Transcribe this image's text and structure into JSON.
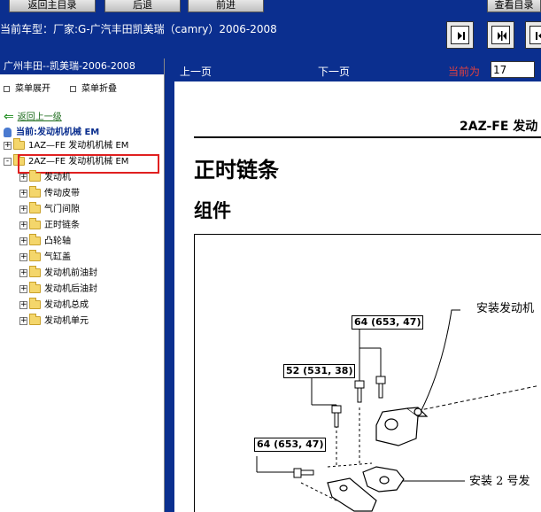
{
  "toolbar": {
    "btn_home": "返回主目录",
    "btn_back": "后退",
    "btn_forward": "前进",
    "btn_view": "查看目录"
  },
  "car_line": "当前车型：厂家:G-广汽丰田凯美瑞（camry）2006-2008",
  "left_panel": {
    "title": "广州丰田--凯美瑞-2006-2008",
    "expand_label": "菜单展开",
    "collapse_label": "菜单折叠",
    "back_link": "返回上一级",
    "current_label": "当前:发动机机械  EM",
    "tree": [
      {
        "label": "1AZ—FE 发动机机械 EM",
        "toggle": "+"
      },
      {
        "label": "2AZ—FE 发动机机械 EM",
        "toggle": "-"
      },
      {
        "label": "发动机",
        "toggle": "+"
      },
      {
        "label": "传动皮带",
        "toggle": "+"
      },
      {
        "label": "气门间隙",
        "toggle": "+"
      },
      {
        "label": "正时链条",
        "toggle": "+"
      },
      {
        "label": "凸轮轴",
        "toggle": "+"
      },
      {
        "label": "气缸盖",
        "toggle": "+"
      },
      {
        "label": "发动机前油封",
        "toggle": "+"
      },
      {
        "label": "发动机后油封",
        "toggle": "+"
      },
      {
        "label": "发动机总成",
        "toggle": "+"
      },
      {
        "label": "发动机单元",
        "toggle": "+"
      }
    ]
  },
  "content_nav": {
    "prev_label": "上一页",
    "next_label": "下一页",
    "current_label": "当前为",
    "page_value": "17"
  },
  "document": {
    "header": "2AZ-FE 发动",
    "title": "正时链条",
    "subtitle": "组件",
    "torques": [
      "64 (653, 47)",
      "52 (531, 38)",
      "64 (653, 47)"
    ],
    "callouts": [
      "安装发动机",
      "安装 2 号发"
    ]
  },
  "colors": {
    "chrome_blue": "#0b2f8f",
    "highlight_red": "#e02020",
    "current_label_red": "#e04040",
    "folder_yellow": "#f4d66b"
  }
}
